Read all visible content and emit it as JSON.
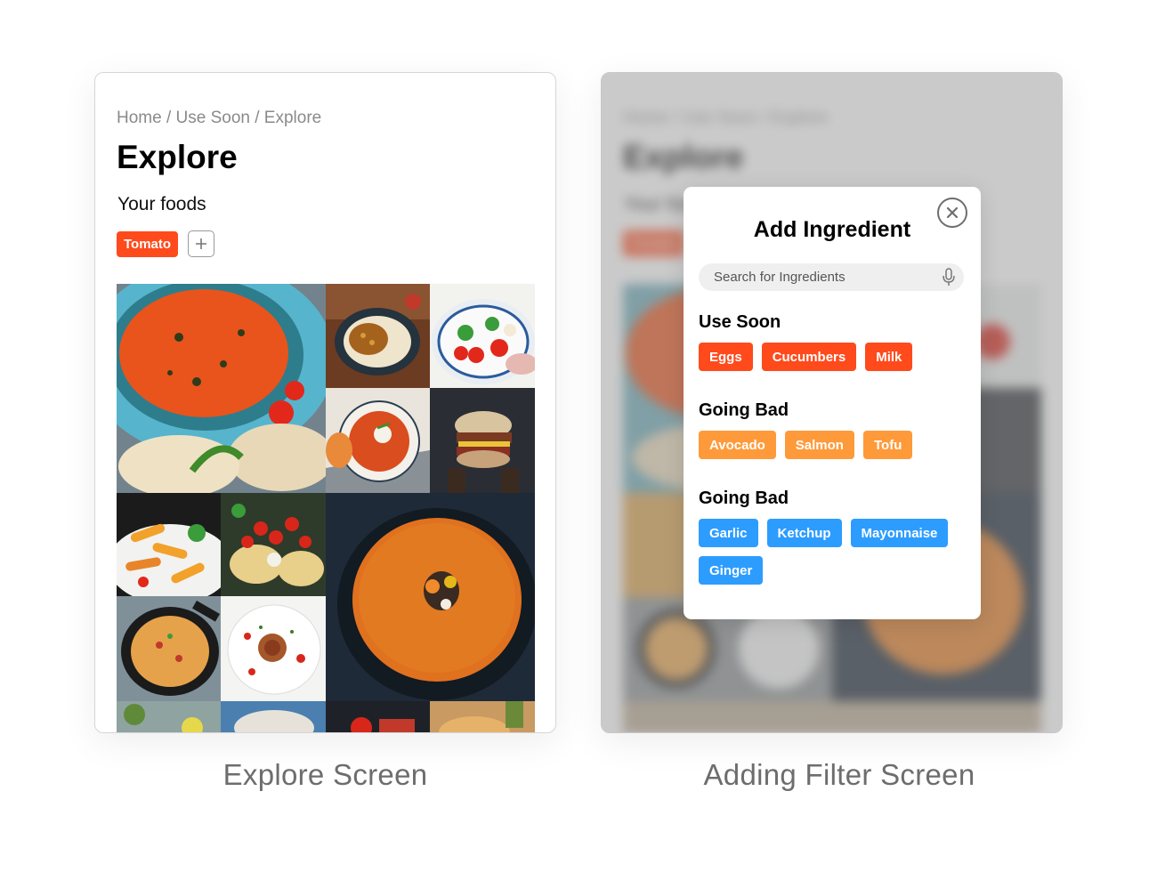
{
  "explore_screen": {
    "breadcrumb": "Home / Use Soon / Explore",
    "title": "Explore",
    "your_foods_label": "Your foods",
    "food_chips": [
      "Tomato"
    ],
    "add_icon": "plus-icon",
    "gallery_icon_names": [
      "tomato-soup-plate",
      "chickpea-rice-dish",
      "caprese-salad-bowl",
      "tomato-soup-bowl",
      "burger-sandwich",
      "penne-pasta",
      "tagliatelle-tomatoes",
      "pumpkin-soup",
      "paella-pan",
      "spaghetti-plate",
      "salad-plate",
      "tomato-jar",
      "pizza-plate"
    ]
  },
  "filter_screen": {
    "modal_title": "Add Ingredient",
    "search_placeholder": "Search for Ingredients",
    "close_icon": "close-icon",
    "mic_icon": "microphone-icon",
    "groups": [
      {
        "title": "Use Soon",
        "color": "#ff4a1c",
        "items": [
          "Eggs",
          "Cucumbers",
          "Milk"
        ]
      },
      {
        "title": "Going Bad",
        "color": "#ff9a3a",
        "items": [
          "Avocado",
          "Salmon",
          "Tofu"
        ]
      },
      {
        "title": "Going Bad",
        "color": "#2d9cff",
        "items": [
          "Garlic",
          "Ketchup",
          "Mayonnaise",
          "Ginger"
        ]
      }
    ]
  },
  "captions": {
    "left": "Explore Screen",
    "right": "Adding Filter Screen"
  },
  "colors": {
    "accent_red": "#ff4a1c",
    "accent_orange": "#ff9a3a",
    "accent_blue": "#2d9cff"
  }
}
